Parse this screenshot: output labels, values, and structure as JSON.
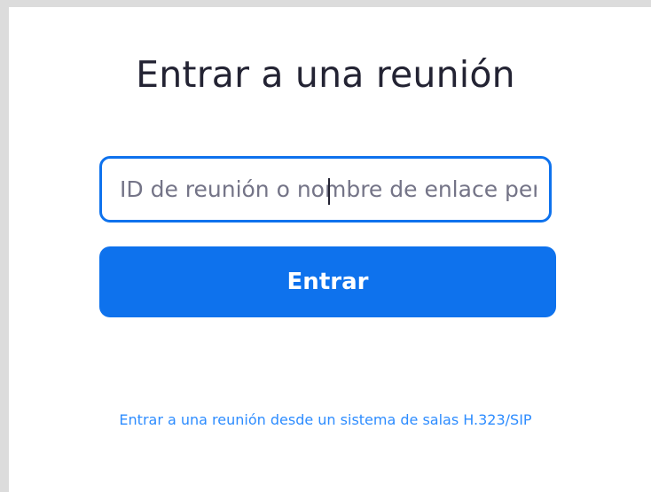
{
  "dialog": {
    "title": "Entrar a una reunión",
    "meeting_input": {
      "placeholder": "ID de reunión o nombre de enlace personal",
      "value": ""
    },
    "join_button_label": "Entrar",
    "room_system_link": "Entrar a una reunión desde un sistema de salas H.323/SIP"
  },
  "colors": {
    "accent": "#0e72ed",
    "link": "#2d8cff",
    "title_text": "#232333",
    "placeholder_text": "#747487",
    "frame_bg": "#dcdcdc"
  }
}
